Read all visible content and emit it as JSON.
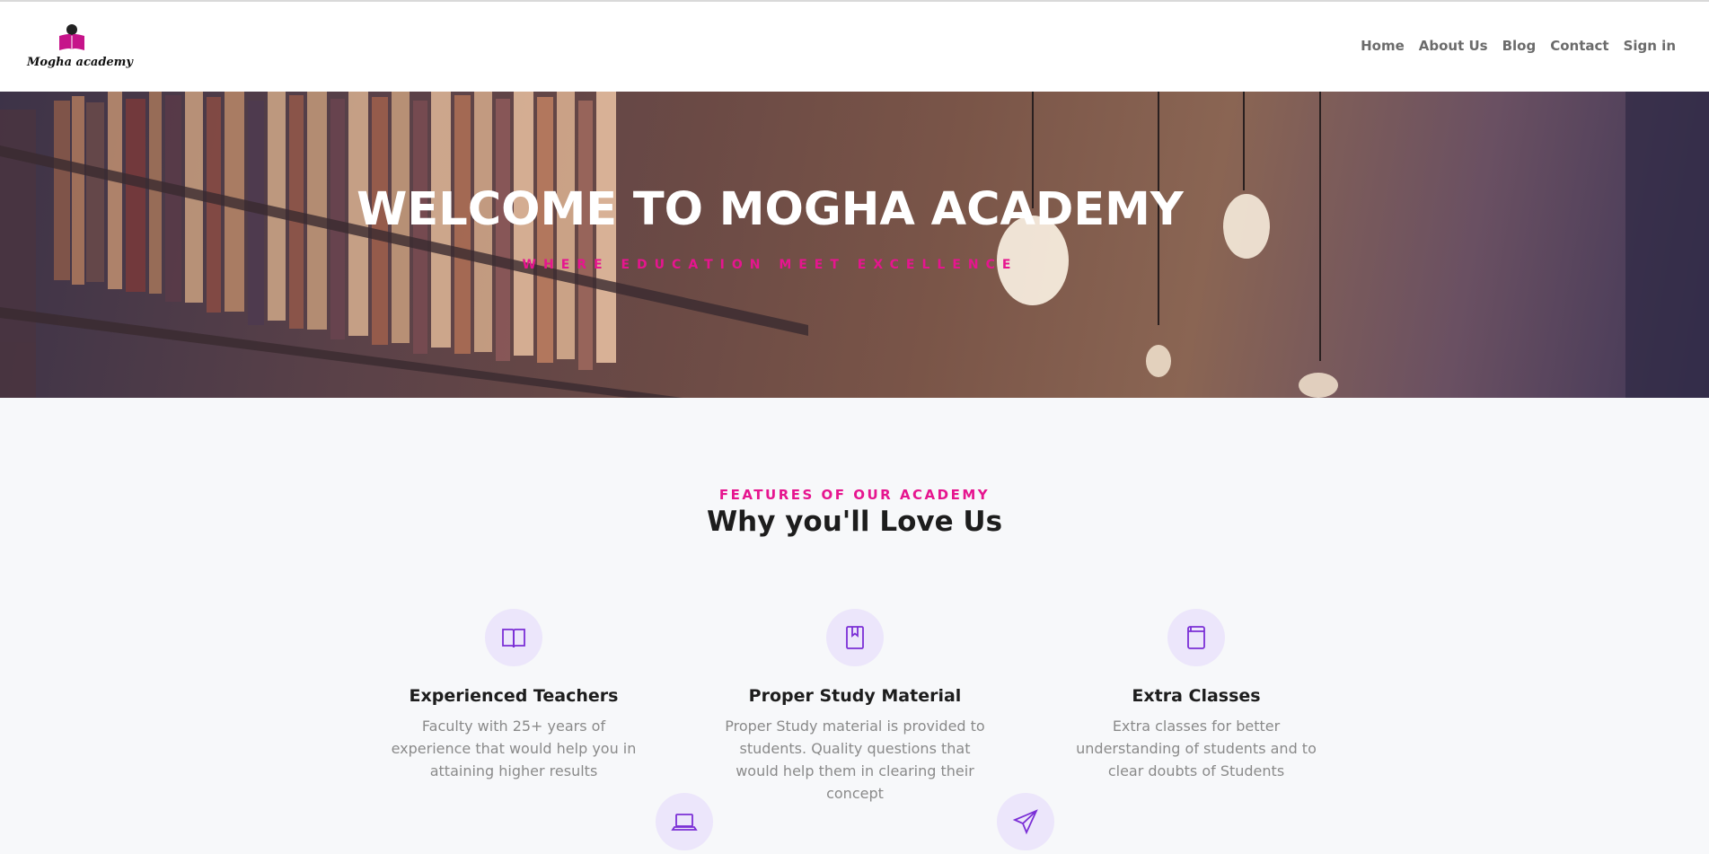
{
  "brand": {
    "name": "Mogha academy"
  },
  "nav": {
    "items": [
      {
        "label": "Home"
      },
      {
        "label": "About Us"
      },
      {
        "label": "Blog"
      },
      {
        "label": "Contact"
      },
      {
        "label": "Sign in"
      }
    ]
  },
  "hero": {
    "title": "WELCOME TO MOGHA ACADEMY",
    "subtitle": "WHERE EDUCATION MEET EXCELLENCE"
  },
  "features": {
    "eyebrow": "FEATURES OF OUR ACADEMY",
    "title": "Why you'll Love Us",
    "items": [
      {
        "icon": "open-book-icon",
        "title": "Experienced Teachers",
        "text": "Faculty with 25+ years of experience that would help you in attaining higher results"
      },
      {
        "icon": "bookmark-book-icon",
        "title": "Proper Study Material",
        "text": "Proper Study material is provided to students. Quality questions that would help them in clearing their concept"
      },
      {
        "icon": "book-icon",
        "title": "Extra Classes",
        "text": "Extra classes for better understanding of students and to clear doubts of Students"
      },
      {
        "icon": "laptop-icon"
      },
      {
        "icon": "paper-plane-icon"
      }
    ]
  },
  "colors": {
    "accent": "#e6158f",
    "icon": "#7b2fd6",
    "icon_bg": "#ece6fb"
  }
}
